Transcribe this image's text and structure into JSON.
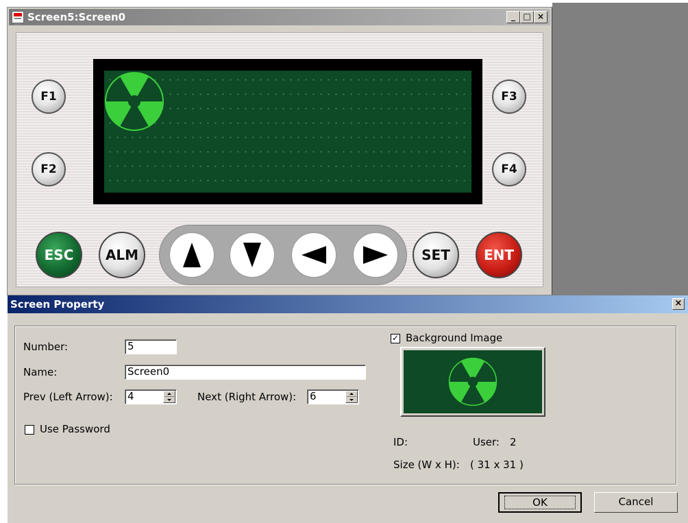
{
  "simulator": {
    "title": "Screen5:Screen0",
    "window_buttons": [
      "_",
      "□",
      "×"
    ],
    "function_keys": [
      "F1",
      "F2",
      "F3",
      "F4"
    ],
    "bottom_keys": {
      "esc": "ESC",
      "alm": "ALM",
      "set": "SET",
      "ent": "ENT"
    },
    "arrow_keys": [
      "up",
      "down",
      "left",
      "right"
    ],
    "lcd_icon": "radiation-icon",
    "colors": {
      "lcd_bg": "#0d4a25",
      "icon_green": "#3ccf3c"
    }
  },
  "dialog": {
    "title": "Screen Property",
    "close_glyph": "×",
    "number_label": "Number:",
    "number_value": "5",
    "name_label": "Name:",
    "name_value": "Screen0",
    "prev_label": "Prev (Left Arrow):",
    "prev_value": "4",
    "next_label": "Next (Right Arrow):",
    "next_value": "6",
    "use_password_label": "Use Password",
    "use_password_checked": false,
    "background_image_label": "Background Image",
    "background_image_checked": true,
    "id_label": "ID:",
    "user_label": "User:",
    "user_value": "2",
    "size_label": "Size (W x H):",
    "size_value": "( 31 x 31 )",
    "ok_label": "OK",
    "cancel_label": "Cancel"
  }
}
